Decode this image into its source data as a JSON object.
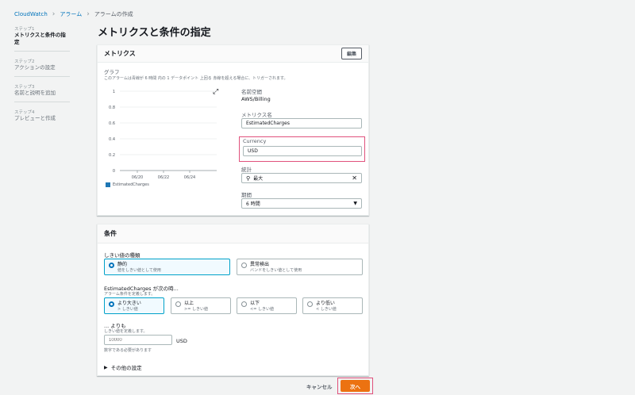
{
  "breadcrumb": [
    "CloudWatch",
    "アラーム",
    "アラームの作成"
  ],
  "steps": [
    {
      "num": "ステップ1",
      "label": "メトリクスと条件の指定",
      "active": true
    },
    {
      "num": "ステップ2",
      "label": "アクションの設定",
      "active": false
    },
    {
      "num": "ステップ3",
      "label": "名前と説明を追加",
      "active": false
    },
    {
      "num": "ステップ4",
      "label": "プレビューと作成",
      "active": false
    }
  ],
  "page_title": "メトリクスと条件の指定",
  "metrics": {
    "heading": "メトリクス",
    "edit_label": "編集",
    "graph_label": "グラフ",
    "graph_desc": "このアラームは青線が 6 時間 内の 1 データポイント 上回る 赤線を超える場合に、トリガーされます。",
    "namespace_label": "名前空間",
    "namespace_value": "AWS/Billing",
    "metric_name_label": "メトリクス名",
    "metric_name_value": "EstimatedCharges",
    "currency_label": "Currency",
    "currency_value": "USD",
    "statistic_label": "統計",
    "statistic_value": "最大",
    "period_label": "期間",
    "period_value": "6 時間"
  },
  "chart_data": {
    "type": "line",
    "x": [
      "06/20",
      "06/22",
      "06/24"
    ],
    "yticks": [
      "1",
      "0.8",
      "0.6",
      "0.4",
      "0.2",
      "0"
    ],
    "ylim": [
      0,
      1
    ],
    "series": [
      {
        "name": "EstimatedCharges",
        "values": []
      }
    ],
    "legend_color": "#1f77b4",
    "grid": true
  },
  "conditions": {
    "heading": "条件",
    "threshold_type_label": "しきい値の種類",
    "threshold_options": [
      {
        "title": "静的",
        "sub": "値をしきい値として使用",
        "selected": true
      },
      {
        "title": "異常検出",
        "sub": "バンドをしきい値として使用",
        "selected": false
      }
    ],
    "when_label": "EstimatedCharges が次の時...",
    "when_sub": "アラーム条件を定義します。",
    "compare_options": [
      {
        "title": "より大きい",
        "sub": "> しきい値",
        "selected": true
      },
      {
        "title": "以上",
        "sub": ">= しきい値",
        "selected": false
      },
      {
        "title": "以下",
        "sub": "<= しきい値",
        "selected": false
      },
      {
        "title": "より低い",
        "sub": "< しきい値",
        "selected": false
      }
    ],
    "than_label": "... よりも",
    "than_sub": "しきい値を定義します。",
    "threshold_placeholder": "10000",
    "threshold_unit": "USD",
    "threshold_hint": "数字である必要があります",
    "other_settings": "その他の設定"
  },
  "footer": {
    "cancel": "キャンセル",
    "next": "次へ"
  },
  "colors": {
    "primary": "#ec7211",
    "highlight": "#e0517c",
    "link": "#0073bb"
  }
}
